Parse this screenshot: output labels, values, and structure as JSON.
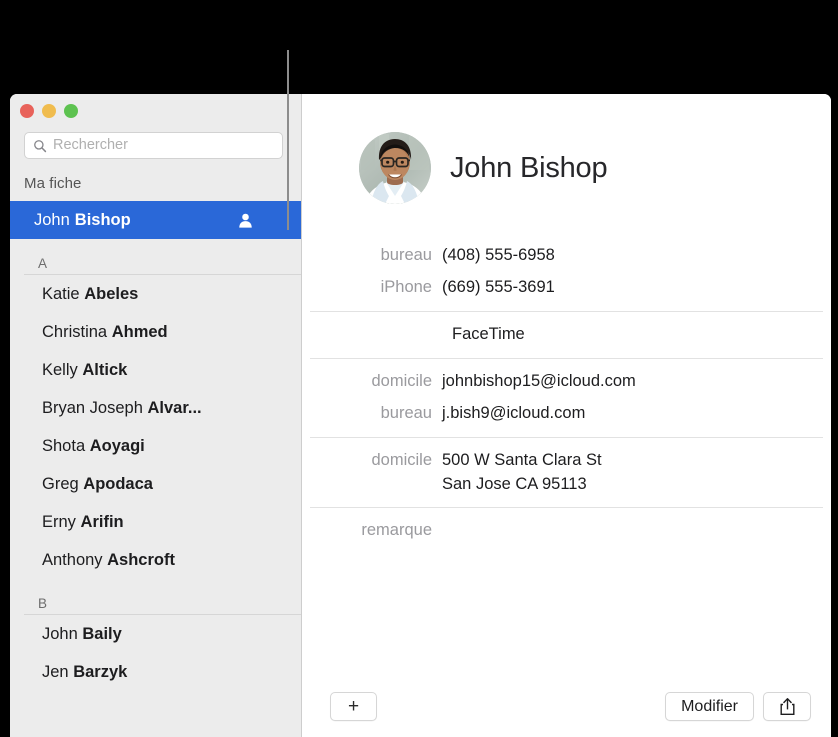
{
  "window": {
    "traffic_lights": [
      {
        "name": "close",
        "color": "#e8625a"
      },
      {
        "name": "minimize",
        "color": "#f0bc4e"
      },
      {
        "name": "zoom",
        "color": "#5dc250"
      }
    ]
  },
  "sidebar": {
    "search": {
      "placeholder": "Rechercher",
      "value": "",
      "icon": "search-icon"
    },
    "my_card_header": "Ma fiche",
    "my_card": {
      "first": "John",
      "last": "Bishop",
      "icon": "person-card-icon",
      "selected": true
    },
    "sections": [
      {
        "letter": "A",
        "contacts": [
          {
            "first": "Katie",
            "last": "Abeles"
          },
          {
            "first": "Christina",
            "last": "Ahmed"
          },
          {
            "first": "Kelly",
            "last": "Altick"
          },
          {
            "first": "Bryan Joseph",
            "last": "Alvar..."
          },
          {
            "first": "Shota",
            "last": "Aoyagi"
          },
          {
            "first": "Greg",
            "last": "Apodaca"
          },
          {
            "first": "Erny",
            "last": "Arifin"
          },
          {
            "first": "Anthony",
            "last": "Ashcroft"
          }
        ]
      },
      {
        "letter": "B",
        "contacts": [
          {
            "first": "John",
            "last": "Baily"
          },
          {
            "first": "Jen",
            "last": "Barzyk"
          }
        ]
      }
    ]
  },
  "detail": {
    "name": "John Bishop",
    "avatar_alt": "contact-photo",
    "fields": [
      {
        "label": "bureau",
        "value": "(408) 555-6958"
      },
      {
        "label": "iPhone",
        "value": "(669) 555-3691"
      },
      {
        "label": "",
        "value": "FaceTime",
        "centered": true
      },
      {
        "label": "domicile",
        "value": "johnbishop15@icloud.com"
      },
      {
        "label": "bureau",
        "value": "j.bish9@icloud.com"
      },
      {
        "label": "domicile",
        "value": "500 W Santa Clara St\nSan Jose CA 95113"
      },
      {
        "label": "remarque",
        "value": ""
      }
    ]
  },
  "bottom_bar": {
    "add_label": "+",
    "edit_label": "Modifier",
    "share_icon": "share-icon"
  },
  "colors": {
    "selection_blue": "#2a68d8",
    "sidebar_bg": "#ececec",
    "label_gray": "#9a9a9e"
  }
}
